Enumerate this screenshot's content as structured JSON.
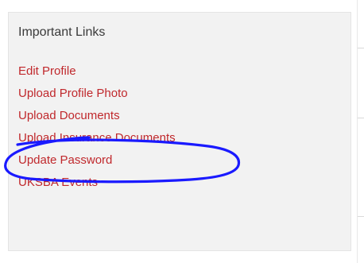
{
  "panel": {
    "title": "Important Links",
    "links": [
      {
        "label": "Edit Profile"
      },
      {
        "label": "Upload Profile Photo"
      },
      {
        "label": "Upload Documents"
      },
      {
        "label": "Upload Insurance Documents"
      },
      {
        "label": "Update Password"
      },
      {
        "label": "UKSBA Events"
      }
    ]
  },
  "colors": {
    "link": "#c0282c",
    "panel_background": "#f2f2f2",
    "annotation_ink": "#1a1aff"
  },
  "icons": {
    "annotation": "hand-drawn-circle-icon"
  }
}
